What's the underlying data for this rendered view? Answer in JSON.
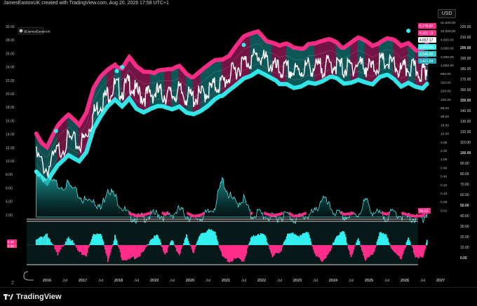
{
  "header": {
    "attribution": "JamesEastonUK created with TradingView.com, Aug 20, 2026 17:58 UTC+1",
    "currency": "USD",
    "watermark": "@JamesEastonUK"
  },
  "footer": {
    "brand": "TradingView",
    "timezone_marker": "Z"
  },
  "colors": {
    "pink": "#ff2d8a",
    "cyan": "#33f0f0",
    "teal_dark": "#0b5c5c",
    "price_line": "#ffffff",
    "background": "#000000"
  },
  "chart_data": [
    {
      "type": "line",
      "id": "price_log",
      "x_ticks": [
        "2016",
        "Jul",
        "2017",
        "Jul",
        "2018",
        "Jul",
        "2019",
        "Jul",
        "2020",
        "Jul",
        "2021",
        "Jul",
        "2022",
        "Jul",
        "2023",
        "Jul",
        "2024",
        "Jul",
        "2025",
        "Jul",
        "2026",
        "Jul",
        "2027"
      ],
      "left_axis_ticks": [
        "30.00",
        "28.00",
        "26.00",
        "24.00",
        "22.00",
        "20.00",
        "18.00",
        "16.00",
        "14.00",
        "12.00",
        "10.00",
        "8.00",
        "6.00",
        "4.00",
        "2.00"
      ],
      "right_axis_ticks_inner": [
        "31,000.00",
        "10,000.00",
        "4,500.00",
        "3,000.00",
        "2,000.00",
        "1,500.00",
        "660.00",
        "320.00",
        "220.00",
        "125.00",
        "68.00",
        "38.00",
        "18.00",
        "10.00",
        "4.55",
        "2.20",
        "1.05",
        "0.60",
        "0.40",
        "0.22",
        "0.10",
        "0.05",
        "0.01"
      ],
      "right_axis_ticks_outer": [
        "220.00",
        "210.00",
        "200.00",
        "190.00",
        "180.00",
        "170.00",
        "160.00",
        "150.00",
        "140.00",
        "130.00",
        "120.00",
        "110.00",
        "100.00",
        "90.00",
        "80.00",
        "70.00",
        "60.00",
        "50.00",
        "40.00",
        "30.00",
        "20.00",
        "10.00",
        "0.00"
      ],
      "price_labels": [
        "5,775.97",
        "4,331.13",
        "4,657.17",
        "3,963.85",
        "3,545.00",
        "3,421.84"
      ],
      "osc_label": "66.63",
      "lower_labels": [
        "6.26",
        "2.34"
      ],
      "x": [
        2015.7,
        2016.0,
        2016.3,
        2016.6,
        2016.9,
        2017.1,
        2017.3,
        2017.5,
        2017.7,
        2017.9,
        2018.1,
        2018.3,
        2018.5,
        2018.7,
        2018.9,
        2019.1,
        2019.3,
        2019.5,
        2019.7,
        2019.9,
        2020.1,
        2020.3,
        2020.5,
        2020.7,
        2020.9,
        2021.1,
        2021.3,
        2021.5,
        2021.7,
        2021.9,
        2022.1,
        2022.3,
        2022.5,
        2022.7,
        2022.9,
        2023.1,
        2023.3,
        2023.5,
        2023.7,
        2023.9,
        2024.1,
        2024.3,
        2024.5,
        2024.7,
        2024.9,
        2025.1,
        2025.3,
        2025.5,
        2025.7,
        2025.9,
        2026.1,
        2026.3,
        2026.5,
        2026.62
      ],
      "series": [
        {
          "values": [
            13.5,
            11.5,
            14.2,
            16.0,
            15.2,
            16.5,
            19.8,
            21.5,
            22.8,
            24.0,
            23.2,
            24.5,
            23.0,
            22.4,
            22.8,
            23.0,
            22.7,
            22.6,
            23.2,
            22.4,
            22.2,
            22.6,
            23.2,
            24.0,
            24.4,
            25.5,
            26.5,
            27.5,
            27.9,
            28.5,
            27.8,
            27.0,
            26.2,
            26.4,
            26.0,
            26.3,
            26.9,
            26.6,
            26.8,
            27.2,
            27.1,
            26.5,
            26.8,
            27.3,
            26.9,
            26.5,
            27.4,
            27.5,
            27.0,
            26.1,
            26.8,
            26.3,
            26.0,
            26.6
          ]
        },
        {
          "values": [
            10.9,
            9.4,
            9.0,
            8.8,
            7.2,
            6.4,
            6.8,
            5.2,
            8.6,
            7.1,
            5.6,
            4.2,
            3.9,
            4.0,
            4.3,
            4.6,
            4.1,
            4.5,
            5.2,
            4.3,
            3.8,
            4.0,
            4.6,
            5.8,
            9.6,
            7.2,
            6.0,
            6.9,
            4.2,
            4.8,
            4.2,
            3.9,
            4.1,
            4.5,
            3.8,
            4.0,
            4.4,
            4.8,
            7.1,
            5.5,
            4.6,
            4.1,
            4.2,
            4.5,
            6.6,
            4.9,
            4.4,
            4.1,
            4.8,
            4.3,
            4.0,
            3.8,
            3.9,
            4.6
          ]
        },
        {
          "values": [
            30,
            70,
            -55,
            60,
            -40,
            -50,
            65,
            75,
            -80,
            55,
            -70,
            -75,
            -60,
            -35,
            40,
            55,
            -45,
            30,
            -50,
            55,
            -35,
            70,
            85,
            80,
            -60,
            -85,
            -70,
            -80,
            40,
            70,
            55,
            -55,
            -40,
            60,
            70,
            55,
            80,
            -55,
            -80,
            -40,
            60,
            75,
            -60,
            40,
            -75,
            -50,
            70,
            55,
            -40,
            -65,
            40,
            -55,
            -70,
            35
          ]
        }
      ]
    }
  ]
}
